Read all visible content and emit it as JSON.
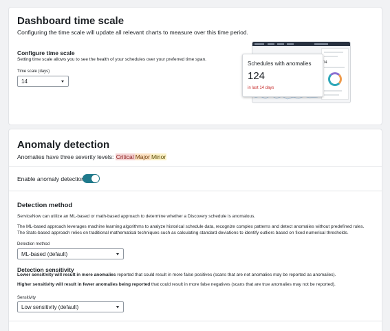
{
  "time_scale": {
    "title": "Dashboard time scale",
    "description": "Configuring the time scale will update all relevant charts to measure over this time period.",
    "configure_heading": "Configure time scale",
    "configure_text": "Setting time scale allows you to see the health of your schedules over your preferred time span.",
    "field_label": "Time scale (days)",
    "value": "14",
    "preview": {
      "card_title": "Schedules with anomalies",
      "card_value": "124",
      "card_subtext": "in last 14 days",
      "mini_value": "74"
    }
  },
  "anomaly": {
    "title": "Anomaly detection",
    "severity_text": "Anomalies have three severity levels:",
    "severity_levels": [
      "Critical",
      "Major",
      "Minor"
    ],
    "toggle_label": "Enable anomaly detection",
    "toggle_on": true
  },
  "detection_method": {
    "heading": "Detection method",
    "intro": "ServiceNow can utilize an ML-based or math-based approach to determine whether a Discovery schedule is anomalous.",
    "ml_text": "The ML-based approach leverages machine learning algorithms to analyze historical schedule data, recognize complex patterns and detect anomalies without predefined rules.",
    "stats_text": "The Stats-based approach relies on traditional mathematical techniques such as calculating standard deviations to identify outliers based on fixed numerical thresholds.",
    "field_label": "Detection method",
    "value": "ML-based (default)"
  },
  "sensitivity": {
    "heading": "Detection sensitivity",
    "lower_bold": "Lower sensitivity will result in more anomalies",
    "lower_rest": " reported that could result in more false positives (scans that are not anomalies may be reported as anomalies).",
    "higher_bold": "Higher sensitivity will result in fewer anomalies being reported",
    "higher_rest": " that could result in more false negatives (scans that are true anomalies may not be reported).",
    "field_label": "Sensitivity",
    "value": "Low sensitivity (default)"
  },
  "colors": {
    "toggle_on": "#1f7a8c",
    "critical_bg": "#f5d3d3",
    "major_bg": "#fde3c5",
    "minor_bg": "#fbf1c6",
    "alert_text": "#c62b2b"
  }
}
